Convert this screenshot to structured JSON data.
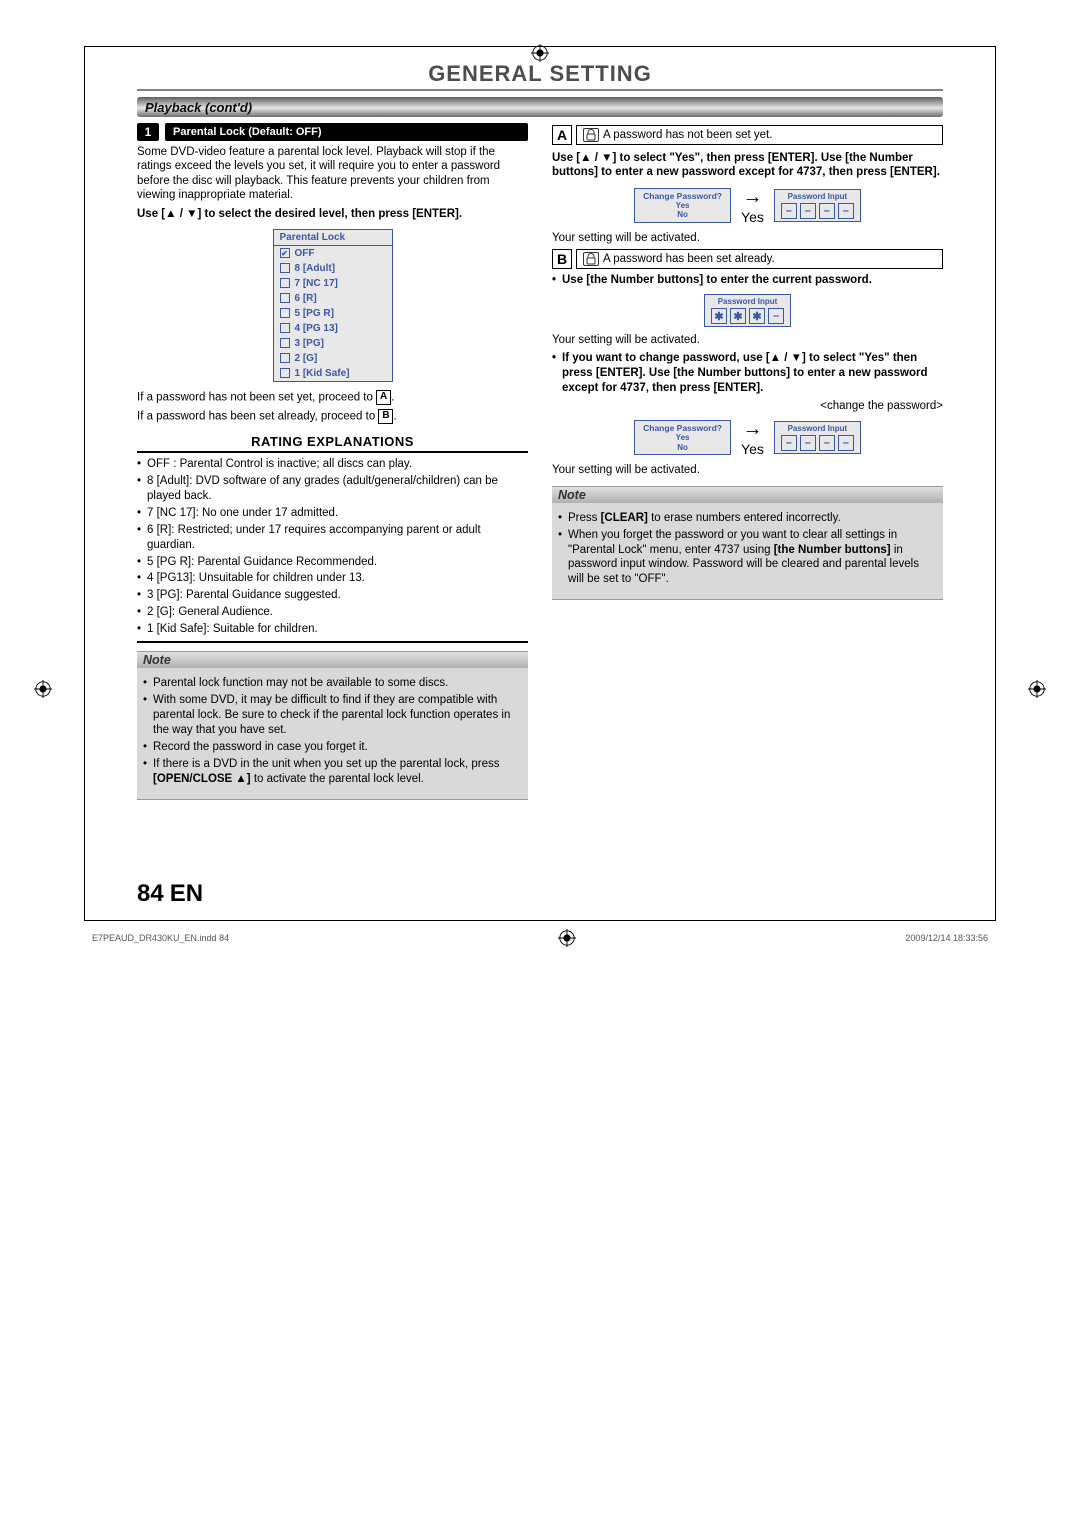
{
  "page": {
    "title": "GENERAL SETTING",
    "section_bar": "Playback (cont'd)",
    "page_number": "84",
    "page_lang": "EN",
    "footer_file": "E7PEAUD_DR430KU_EN.indd   84",
    "footer_date": "2009/12/14   18:33:56"
  },
  "left": {
    "step": {
      "num": "1",
      "label": "Parental Lock (Default: OFF)"
    },
    "intro": "Some DVD-video feature a parental lock level. Playback will stop if the ratings exceed the levels you set, it will require you to enter a password before the disc will playback. This feature prevents your children from viewing inappropriate material.",
    "instruction": "Use [▲ / ▼] to select the desired level, then press [ENTER].",
    "menu": {
      "title": "Parental Lock",
      "items": [
        "OFF",
        "8 [Adult]",
        "7 [NC 17]",
        "6 [R]",
        "5 [PG R]",
        "4 [PG 13]",
        "3 [PG]",
        "2 [G]",
        "1 [Kid Safe]"
      ]
    },
    "after_menu_1a": "If a password has not been set yet, proceed to ",
    "after_menu_1b": "A",
    "after_menu_1c": ".",
    "after_menu_2a": "If a password has been set already, proceed to ",
    "after_menu_2b": "B",
    "after_menu_2c": ".",
    "ratings_head": "RATING EXPLANATIONS",
    "ratings": [
      "OFF : Parental Control is inactive; all discs can play.",
      "8 [Adult]: DVD software of any grades (adult/general/children) can be played back.",
      "7 [NC 17]: No one under 17 admitted.",
      "6 [R]: Restricted; under 17 requires accompanying parent or adult guardian.",
      "5 [PG R]: Parental Guidance Recommended.",
      "4 [PG13]: Unsuitable for children under 13.",
      "3 [PG]: Parental Guidance suggested.",
      "2 [G]: General Audience.",
      "1 [Kid Safe]: Suitable for children."
    ],
    "note": {
      "title": "Note",
      "items": [
        "Parental lock function may not be available to some discs.",
        "With some DVD, it may be difficult to find if they are compatible with parental lock. Be sure to check if the parental lock function operates in the way that you have set.",
        "Record the password in case you forget it.",
        "If there is a DVD in the unit when you set up the parental lock, press [OPEN/CLOSE ▲] to activate the parental lock level."
      ]
    }
  },
  "right": {
    "A": {
      "letter": "A",
      "text": "A password has not been set yet."
    },
    "A_inst": "Use [▲ / ▼] to select \"Yes\", then press [ENTER]. Use [the Number buttons] to enter a new password except for 4737, then press [ENTER].",
    "dlg": {
      "title": "Change Password?",
      "yes": "Yes",
      "no": "No"
    },
    "arrow_label": "Yes",
    "pw_title": "Password Input",
    "A_after": "Your setting will be activated.",
    "B": {
      "letter": "B",
      "text": "A password has been set already."
    },
    "B_inst": "Use [the Number buttons] to enter the current password.",
    "pw_chars": [
      "✱",
      "✱",
      "✱",
      "–"
    ],
    "B_after": "Your setting will be activated.",
    "change_inst": "If you want to change password, use [▲ / ▼] to select \"Yes\" then press [ENTER]. Use [the Number buttons] to enter a new password except for 4737, then press [ENTER].",
    "change_caption": "<change the password>",
    "change_after": "Your setting will be activated.",
    "note": {
      "title": "Note",
      "items": [
        "Press [CLEAR] to erase numbers entered incorrectly.",
        "When you forget the password or you want to clear all settings in \"Parental Lock\" menu, enter 4737 using [the Number buttons] in password input window. Password will be cleared and parental levels will be set to \"OFF\"."
      ]
    }
  }
}
